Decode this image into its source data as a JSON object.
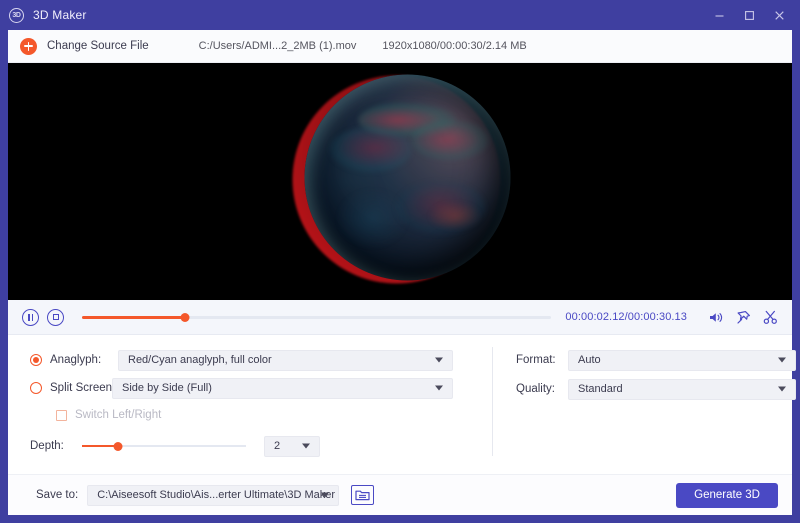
{
  "window": {
    "title": "3D Maker",
    "app_icon": "3d-badge-icon",
    "minimize": "minimize-icon",
    "maximize": "maximize-icon",
    "close": "close-icon",
    "accent": "#4a49c4",
    "orange": "#f4582b"
  },
  "toolbar": {
    "add_icon": "plus-circle-icon",
    "change_source_label": "Change Source File",
    "file_path": "C:/Users/ADMI...2_2MB (1).mov",
    "file_meta": "1920x1080/00:00:30/2.14 MB"
  },
  "preview": {
    "content": "anaglyph-3d-earth-globe"
  },
  "player": {
    "pause_icon": "pause-icon",
    "stop_icon": "stop-icon",
    "seek_percent": 22,
    "timecode": "00:00:02.12/00:00:30.13",
    "volume_icon": "volume-icon",
    "snapshot_icon": "pin-icon",
    "cut_icon": "scissors-icon"
  },
  "settings": {
    "anaglyph": {
      "label": "Anaglyph:",
      "selected": true,
      "value": "Red/Cyan anaglyph, full color"
    },
    "split_screen": {
      "label": "Split Screen:",
      "selected": false,
      "value": "Side by Side (Full)"
    },
    "switch_lr": {
      "label": "Switch Left/Right",
      "checked": false,
      "disabled": true
    },
    "depth": {
      "label": "Depth:",
      "value": "2",
      "percent": 22
    },
    "format": {
      "label": "Format:",
      "value": "Auto"
    },
    "quality": {
      "label": "Quality:",
      "value": "Standard"
    }
  },
  "bottom": {
    "saveto_label": "Save to:",
    "saveto_value": "C:\\Aiseesoft Studio\\Ais...erter Ultimate\\3D Maker",
    "folder_icon": "folder-icon",
    "generate_label": "Generate 3D"
  }
}
